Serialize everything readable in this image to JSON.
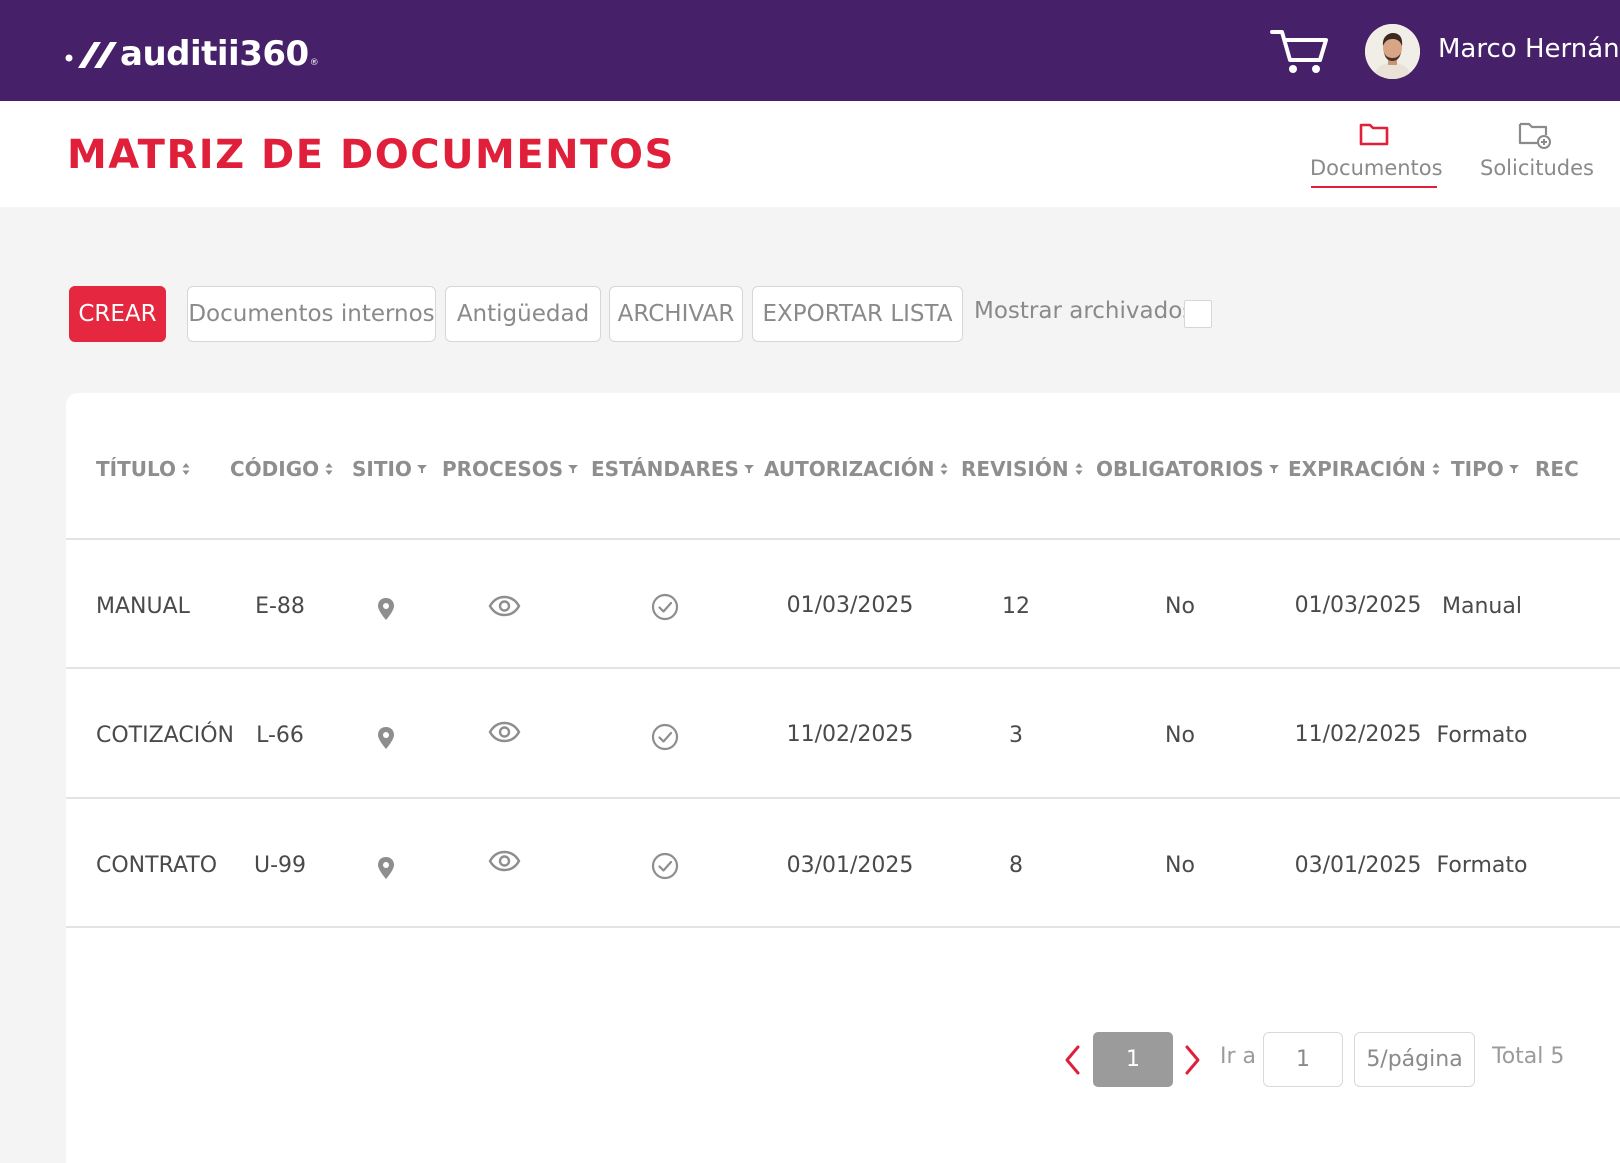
{
  "app": {
    "logo_text": "auditii360",
    "logo_reg": "®"
  },
  "user": {
    "name": "Marco Hernández"
  },
  "header": {
    "title": "MATRIZ DE DOCUMENTOS"
  },
  "nav_tabs": [
    {
      "label": "Documentos",
      "icon": "folder-icon",
      "active": true
    },
    {
      "label": "Solicitudes",
      "icon": "folder-add-icon",
      "active": false
    }
  ],
  "toolbar": {
    "crear": "CREAR",
    "internos": "Documentos internos",
    "antiguedad": "Antigüedad",
    "archivar": "ARCHIVAR",
    "exportar": "EXPORTAR LISTA",
    "mostrar_archivados": "Mostrar archivados",
    "mostrar_checked": false
  },
  "table": {
    "columns": [
      {
        "label": "TÍTULO",
        "control": "sort"
      },
      {
        "label": "CÓDIGO",
        "control": "sort"
      },
      {
        "label": "SITIO",
        "control": "filter"
      },
      {
        "label": "PROCESOS",
        "control": "filter"
      },
      {
        "label": "ESTÁNDARES",
        "control": "filter"
      },
      {
        "label": "AUTORIZACIÓN",
        "control": "sort"
      },
      {
        "label": "REVISIÓN",
        "control": "sort"
      },
      {
        "label": "OBLIGATORIOS",
        "control": "filter"
      },
      {
        "label": "EXPIRACIÓN",
        "control": "sort"
      },
      {
        "label": "TIPO",
        "control": "filter"
      },
      {
        "label": "REC",
        "control": "none"
      }
    ],
    "rows": [
      {
        "titulo": "MANUAL",
        "codigo": "E-88",
        "sitio": "location-pin-icon",
        "procesos": "eye-icon",
        "estandares": "check-circle-icon",
        "autorizacion": "01/03/2025",
        "revision": "12",
        "obligatorios": "No",
        "expiracion": "01/03/2025",
        "tipo": "Manual"
      },
      {
        "titulo": "COTIZACIÓN",
        "codigo": "L-66",
        "sitio": "location-pin-icon",
        "procesos": "eye-icon",
        "estandares": "check-circle-icon",
        "autorizacion": "11/02/2025",
        "revision": "3",
        "obligatorios": "No",
        "expiracion": "11/02/2025",
        "tipo": "Formato"
      },
      {
        "titulo": "CONTRATO",
        "codigo": "U-99",
        "sitio": "location-pin-icon",
        "procesos": "eye-icon",
        "estandares": "check-circle-icon",
        "autorizacion": "03/01/2025",
        "revision": "8",
        "obligatorios": "No",
        "expiracion": "03/01/2025",
        "tipo": "Formato"
      }
    ]
  },
  "pagination": {
    "current_page": "1",
    "goto_label": "Ir a",
    "goto_value": "1",
    "page_size": "5/página",
    "total": "Total 5"
  },
  "colors": {
    "topbar": "#46216a",
    "accent": "#e0203a",
    "crear_button": "#e5283f",
    "page_bg": "#f4f4f4",
    "muted_text": "#8a8a8a"
  }
}
